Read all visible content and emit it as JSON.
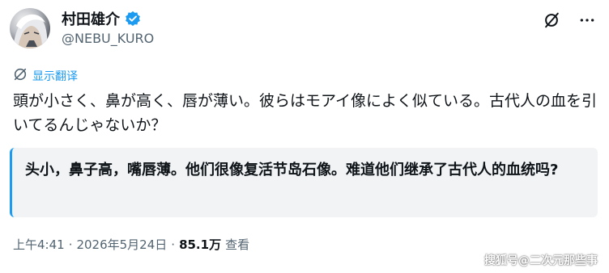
{
  "author": {
    "display_name": "村田雄介",
    "handle": "@NEBU_KURO",
    "verified_icon": "verified-badge-icon",
    "verified_color": "#1d9bf0"
  },
  "header_actions": {
    "grok_icon": "slashed-circle-icon",
    "more_icon": "more-dots-icon"
  },
  "translate": {
    "label": "显示翻译",
    "icon": "translate-icon",
    "color": "#1d9bf0"
  },
  "tweet": {
    "text": "頭が小さく、鼻が高く、唇が薄い。彼らはモアイ像によく似ている。古代人の血を引いてるんじゃないか？"
  },
  "translation": {
    "text": "头小，鼻子高，嘴唇薄。他们很像复活节岛石像。难道他们继承了古代人的血统吗?"
  },
  "meta": {
    "time": "上午4:41",
    "separator": "·",
    "date": "2026年5月24日",
    "views_count": "85.1万",
    "views_label": "查看"
  },
  "watermark": {
    "text": "搜狐号@二次元那些事"
  }
}
